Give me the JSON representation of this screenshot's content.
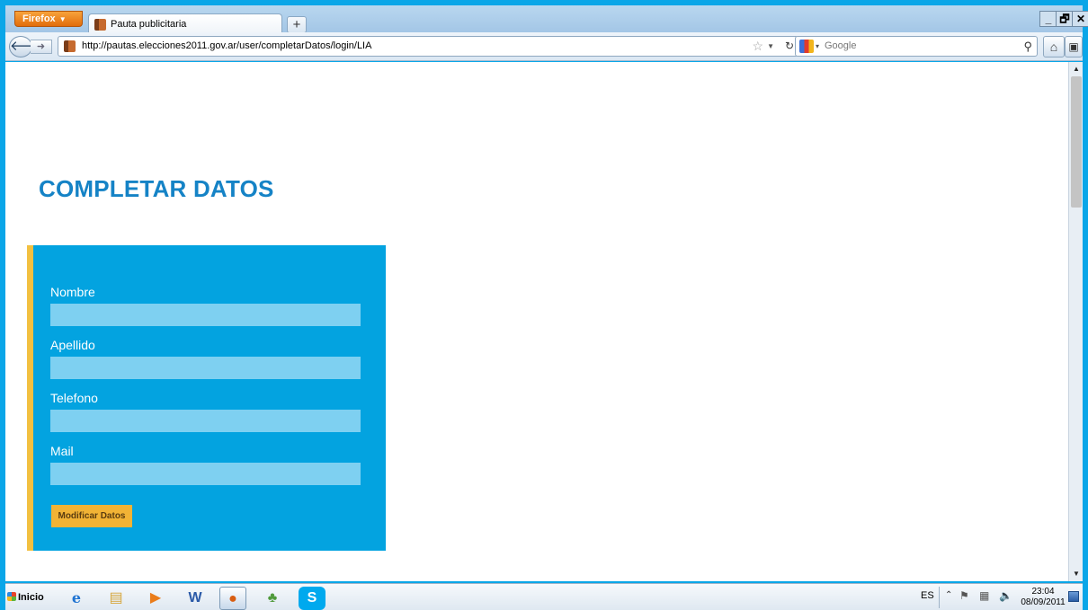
{
  "browser": {
    "app_button": "Firefox",
    "tab_title": "Pauta publicitaria",
    "new_tab_symbol": "+",
    "url": "http://pautas.elecciones2011.gov.ar/user/completarDatos/login/LIA",
    "search_engine": "Google",
    "window_controls": {
      "minimize": "_",
      "maximize": "🗗",
      "close": "✕"
    }
  },
  "page": {
    "title": "COMPLETAR DATOS",
    "form": {
      "fields": [
        {
          "label": "Nombre",
          "value": ""
        },
        {
          "label": "Apellido",
          "value": ""
        },
        {
          "label": "Telefono",
          "value": ""
        },
        {
          "label": "Mail",
          "value": ""
        }
      ],
      "submit_label": "Modificar Datos"
    },
    "colors": {
      "title": "#1583c6",
      "panel": "#03a3e0",
      "accent": "#f2c041",
      "input": "#7ed0f1",
      "button": "#f2b335"
    }
  },
  "taskbar": {
    "start_label": "Inicio",
    "pinned": [
      "internet-explorer-icon",
      "folder-icon",
      "media-player-icon",
      "word-icon",
      "firefox-icon",
      "people-icon",
      "skype-icon"
    ],
    "language": "ES",
    "time": "23:04",
    "date": "08/09/2011"
  }
}
